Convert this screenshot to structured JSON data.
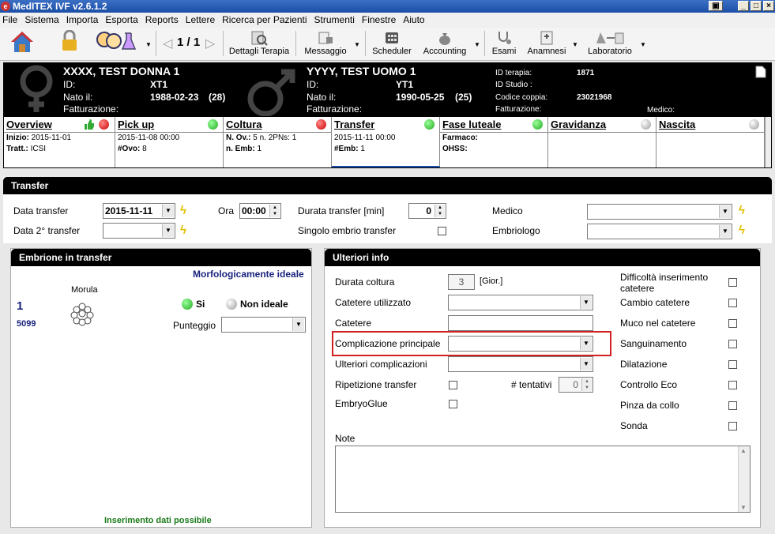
{
  "window": {
    "title": "MedITEX IVF v2.6.1.2"
  },
  "menu": [
    "File",
    "Sistema",
    "Importa",
    "Esporta",
    "Reports",
    "Lettere",
    "Ricerca per Pazienti",
    "Strumenti",
    "Finestre",
    "Aiuto"
  ],
  "toolbar": {
    "pager": "1 / 1",
    "dettagli": "Dettagli Terapia",
    "messaggio": "Messaggio",
    "scheduler": "Scheduler",
    "accounting": "Accounting",
    "esami": "Esami",
    "anamnesi": "Anamnesi",
    "laboratorio": "Laboratorio"
  },
  "patient": {
    "female": {
      "name": "XXXX, TEST DONNA 1",
      "id_label": "ID:",
      "id": "XT1",
      "born_label": "Nato il:",
      "born": "1988-02-23",
      "age": "(28)",
      "billing_label": "Fatturazione:"
    },
    "male": {
      "name": "YYYY, TEST UOMO 1",
      "id_label": "ID:",
      "id": "YT1",
      "born_label": "Nato il:",
      "born": "1990-05-25",
      "age": "(25)",
      "billing_label": "Fatturazione:"
    },
    "therapy_id_label": "ID terapia:",
    "therapy_id": "1871",
    "study_id_label": "ID Studio :",
    "couple_code_label": "Codice coppia:",
    "couple_code": "23021968",
    "billing_label": "Fatturazione:",
    "doctor_label": "Medico:"
  },
  "tabs": [
    {
      "label": "Overview",
      "status": "error",
      "l1k": "Inizio:",
      "l1v": "2015-11-01",
      "l2k": "Tratt.:",
      "l2v": "ICSI"
    },
    {
      "label": "Pick up",
      "status": "ok",
      "l1k": "",
      "l1v": "2015-11-08 00:00",
      "l2k": "#Ovo:",
      "l2v": "8"
    },
    {
      "label": "Coltura",
      "status": "error",
      "l1k": "N. Ov.:",
      "l1v": "5 n. 2PNs: 1",
      "l2k": "n. Emb:",
      "l2v": "1"
    },
    {
      "label": "Transfer",
      "status": "ok",
      "l1k": "",
      "l1v": "2015-11-11 00:00",
      "l2k": "#Emb:",
      "l2v": "1"
    },
    {
      "label": "Fase luteale",
      "status": "ok",
      "l1k": "Farmaco:",
      "l1v": "",
      "l2k": "OHSS:",
      "l2v": ""
    },
    {
      "label": "Gravidanza",
      "status": "none",
      "l1k": "",
      "l1v": "",
      "l2k": "",
      "l2v": ""
    },
    {
      "label": "Nascita",
      "status": "none",
      "l1k": "",
      "l1v": "",
      "l2k": "",
      "l2v": ""
    }
  ],
  "transfer": {
    "title": "Transfer",
    "date_label": "Data transfer",
    "date": "2015-11-11",
    "ora_label": "Ora",
    "ora": "00:00",
    "durata_label": "Durata transfer [min]",
    "durata": "0",
    "medico_label": "Medico",
    "date2_label": "Data 2° transfer",
    "single_label": "Singolo embrio transfer",
    "embriologo_label": "Embriologo"
  },
  "embryo": {
    "title": "Embrione in transfer",
    "morpho": "Morfologicamente ideale",
    "stage": "Morula",
    "number": "1",
    "code": "5099",
    "si": "Si",
    "non_ideale": "Non ideale",
    "punteggio_label": "Punteggio",
    "footer": "Inserimento dati possibile"
  },
  "info": {
    "title": "Ulteriori info",
    "durata_label": "Durata coltura",
    "durata": "3",
    "durata_unit": "[Gior.]",
    "catetere_util_label": "Catetere utilizzato",
    "catetere_label": "Catetere",
    "compl_label": "Complicazione principale",
    "ulteriori_label": "Ulteriori complicazioni",
    "ripetizione_label": "Ripetizione transfer",
    "tentativi_label": "# tentativi",
    "tentativi": "0",
    "embryoglue_label": "EmbryoGlue",
    "note_label": "Note",
    "right": [
      "Difficoltà inserimento catetere",
      "Cambio catetere",
      "Muco nel catetere",
      "Sanguinamento",
      "Dilatazione",
      "Controllo Eco",
      "Pinza da collo",
      "Sonda"
    ]
  },
  "colors": {
    "highlight": "#d02020",
    "green_text": "#1a7a1a",
    "blue_text": "#1a237e"
  }
}
